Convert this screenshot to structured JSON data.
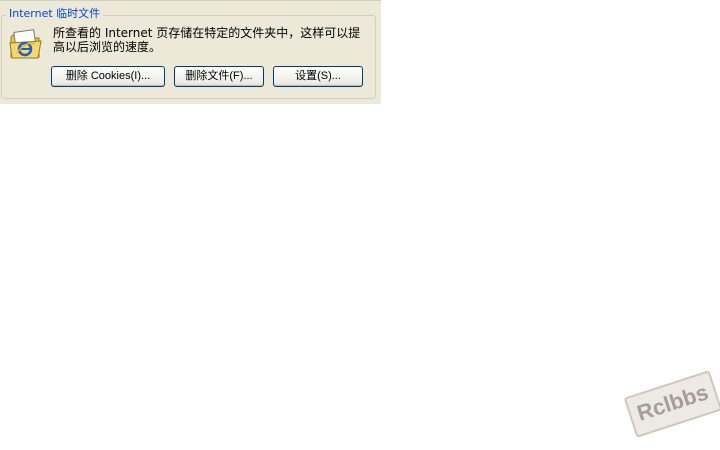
{
  "internet_temp_files": {
    "group_title": "Internet 临时文件",
    "description": "所查看的 Internet 页存储在特定的文件夹中，这样可以提高以后浏览的速度。",
    "icon": "ie-folder-icon",
    "buttons": {
      "delete_cookies": "删除 Cookies(I)...",
      "delete_files": "删除文件(F)...",
      "settings": "设置(S)..."
    }
  },
  "watermark": "Rclbbs"
}
